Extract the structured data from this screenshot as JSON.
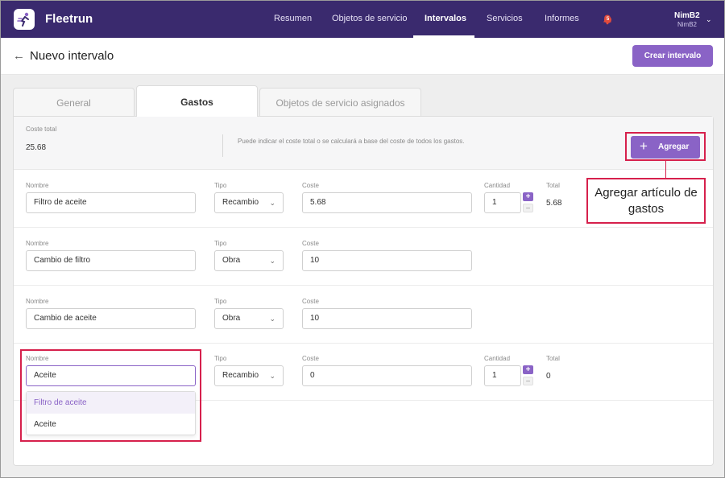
{
  "nav": {
    "brand": "Fleetrun",
    "links": [
      "Resumen",
      "Objetos de servicio",
      "Intervalos",
      "Servicios",
      "Informes"
    ],
    "active": "Intervalos",
    "notifications": "5",
    "user_name": "NimB2",
    "user_sub": "NimB2"
  },
  "header": {
    "title": "Nuevo intervalo",
    "create_button": "Crear intervalo"
  },
  "tabs": [
    "General",
    "Gastos",
    "Objetos de servicio asignados"
  ],
  "cost": {
    "label": "Coste total",
    "value": "25.68",
    "hint": "Puede indicar el coste total o se calculará a base del coste de todos los gastos.",
    "add_button": "Agregar"
  },
  "labels": {
    "name": "Nombre",
    "type": "Tipo",
    "cost": "Coste",
    "quantity": "Cantidad",
    "total": "Total"
  },
  "rows": [
    {
      "name": "Filtro de aceite",
      "type": "Recambio",
      "cost": "5.68",
      "quantity": "1",
      "total": "5.68"
    },
    {
      "name": "Cambio de filtro",
      "type": "Obra",
      "cost": "10"
    },
    {
      "name": "Cambio de aceite",
      "type": "Obra",
      "cost": "10"
    },
    {
      "name": "Aceite",
      "type": "Recambio",
      "cost": "0",
      "quantity": "1",
      "total": "0"
    }
  ],
  "dropdown": [
    "Filtro de aceite",
    "Aceite"
  ],
  "annotation": "Agregar artículo de gastos",
  "colors": {
    "nav_bg": "#3a2a6e",
    "accent": "#8a63c6",
    "annotation": "#d6204c",
    "badge": "#e24b3c"
  }
}
